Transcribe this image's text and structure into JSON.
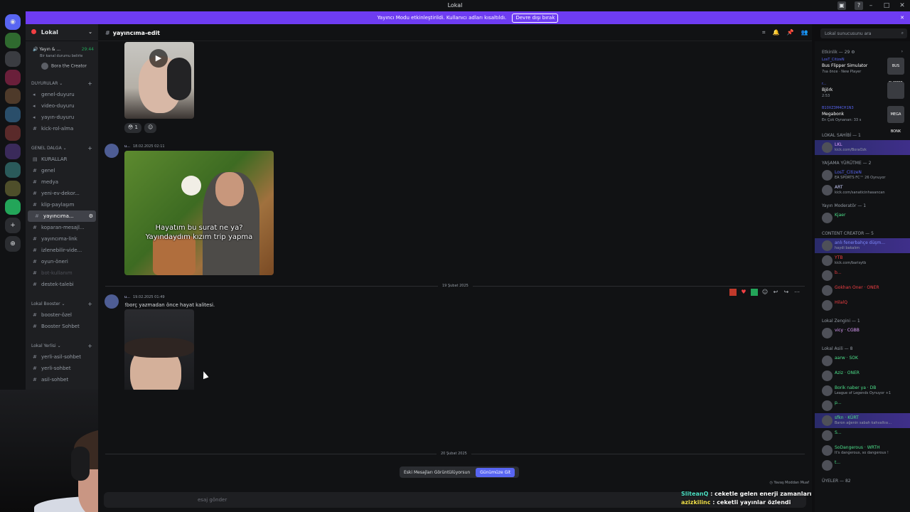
{
  "window": {
    "title": "Lokal"
  },
  "banner": {
    "text": "Yayıncı Modu etkinleştirildi. Kullanıcı adları kısaltıldı.",
    "button": "Devre dışı bırak"
  },
  "guild": {
    "name": "Lokal"
  },
  "voice": {
    "title": "Yayın & ...",
    "time": "29:44",
    "status": "Bir kanal durumu belirle",
    "user": "Bora the Creator"
  },
  "categories": [
    {
      "name": "DUYURULAR",
      "channels": [
        "genel-duyuru",
        "video-duyuru",
        "yayın-duyuru",
        "kick-rol-alma"
      ]
    },
    {
      "name": "GENEL DALGA",
      "channels": [
        "KURALLAR",
        "genel",
        "medya",
        "yeni-ev-dekor...",
        "klip-paylaşım",
        "yayıncıma...",
        "koparan-mesajl...",
        "yayıncıma-link",
        "izlenebilir-vide...",
        "oyun-öneri",
        "bot-kullanım",
        "destek-talebi"
      ]
    },
    {
      "name": "Lokal Booster",
      "channels": [
        "booster-özel",
        "Booster Sohbet"
      ]
    },
    {
      "name": "Lokal Yerlisi",
      "channels": [
        "yerli-asil-sohbet",
        "yerli-sohbet",
        "asil-sohbet"
      ]
    }
  ],
  "chat": {
    "channel": "yayıncıma-edit",
    "reaction_count": "1",
    "msg1": {
      "user": "u...",
      "time": "18.02.2025 02:11",
      "caption1": "Hayatım bu surat ne ya?",
      "caption2": "Yayındaydım kızım trip yapma"
    },
    "divider1": "19 Şubat 2025",
    "msg2": {
      "user": "u...",
      "time": "19.02.2025 01:49",
      "text": "!borç yazmadan önce hayat kalitesi."
    },
    "divider2": "20 Şubat 2025",
    "jump_text": "Eski Mesajları Görüntülüyorsun",
    "jump_button": "Günümüze Git",
    "slowmode": "Yavaş Moddan Muaf",
    "composer_placeholder": "esaj gönder"
  },
  "search": {
    "placeholder": "Lokal sunucusunu ara"
  },
  "members": {
    "activity_header": "Etkinlik — 29",
    "activities": [
      {
        "user": "LosT_CitizeN",
        "game": "Bus Flipper Simulator",
        "status": "7sa önce · New Player",
        "thumb": "BUS FLIPPER"
      },
      {
        "user": "r...",
        "game": "Björk",
        "status": "2:53",
        "thumb": ""
      },
      {
        "user": "B10XZ3M4CH1N3",
        "game": "Megabonk",
        "status": "En Çok Oynanan: 33 s",
        "thumb": "MEGA BONK"
      }
    ],
    "groups": [
      {
        "title": "LOKAL SAHİBİ — 1",
        "members": [
          {
            "name": "LKL",
            "status": "kick.com/BoraOzk",
            "color": "#e0a0ff",
            "hl": true
          }
        ]
      },
      {
        "title": "YAŞAMA YÜRÜTME — 2",
        "members": [
          {
            "name": "LosT_CitizeN",
            "status": "EA SPORTS FC™ 26 Oynuyor",
            "color": "#5865f2"
          },
          {
            "name": "ART",
            "status": "kick.com/sanaticinhasancan",
            "color": "#c9cdfb"
          }
        ]
      },
      {
        "title": "Yayın Moderatör — 1",
        "members": [
          {
            "name": "Kjaer",
            "status": "",
            "color": "#4de08a"
          }
        ]
      },
      {
        "title": "CONTENT CREATOR — 5",
        "members": [
          {
            "name": "anlı fenerbahçe düşm...",
            "status": "haydi bakalım",
            "color": "#7f8bff",
            "hl": true
          },
          {
            "name": "YTB",
            "status": "kick.com/barisytb",
            "color": "#f23f43"
          },
          {
            "name": "b...",
            "status": "",
            "color": "#f23f43"
          },
          {
            "name": "Gokhan Oner · ONER",
            "status": "",
            "color": "#f23f43"
          },
          {
            "name": "HilalQ",
            "status": "",
            "color": "#f23f43"
          }
        ]
      },
      {
        "title": "Lokal Zengini — 1",
        "members": [
          {
            "name": "vicy · CGBB",
            "status": "",
            "color": "#e0a0ff"
          }
        ]
      },
      {
        "title": "Lokal Asili — 8",
        "members": [
          {
            "name": "aarw · SOK",
            "status": "",
            "color": "#4de08a"
          },
          {
            "name": "Aziz · ONER",
            "status": "",
            "color": "#4de08a"
          },
          {
            "name": "Borik naber ya · DB",
            "status": "League of Legends Oynuyor +1",
            "color": "#4de08a"
          },
          {
            "name": "p...",
            "status": "",
            "color": "#4de08a"
          },
          {
            "name": "sfkn · KÜRT",
            "status": "Baron ağenin sabah kahvaltısı...",
            "color": "#4de08a",
            "hl": true
          },
          {
            "name": "S...",
            "status": "",
            "color": "#4de08a"
          },
          {
            "name": "SoDangerous · WRTH",
            "status": "It's dangerous, so dangerous !",
            "color": "#4de08a"
          },
          {
            "name": "t...",
            "status": "",
            "color": "#4de08a"
          }
        ]
      }
    ],
    "footer": "ÜYELER — 82"
  },
  "stream_chat": [
    {
      "user": "SliteanQ",
      "text": ": ceketle gelen enerji zamanları"
    },
    {
      "user": "azizkilinc",
      "text": ": ceketli yayınlar özlendi"
    }
  ]
}
